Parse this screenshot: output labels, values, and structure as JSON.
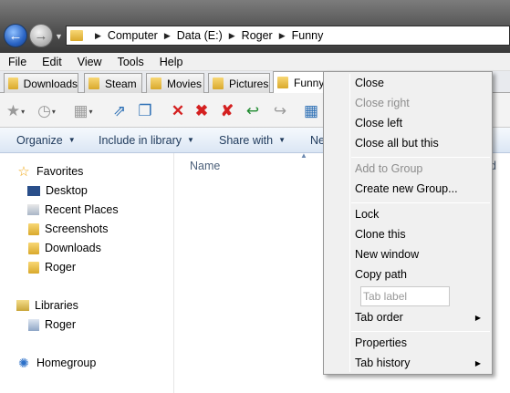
{
  "address": {
    "crumbs": [
      "Computer",
      "Data (E:)",
      "Roger",
      "Funny"
    ]
  },
  "menu": [
    "File",
    "Edit",
    "View",
    "Tools",
    "Help"
  ],
  "tabs": [
    "Downloads",
    "Steam",
    "Movies",
    "Pictures",
    "Funny"
  ],
  "toolbar_icons": [
    "star-icon",
    "history-icon",
    "windows-icon",
    "open-new-icon",
    "clone-icon",
    "close-icon",
    "close-right-icon",
    "close-others-icon",
    "close-left-icon",
    "arrow-icon",
    "view-icon"
  ],
  "commands": {
    "organize": "Organize",
    "include": "Include in library",
    "share": "Share with",
    "new": "Ne"
  },
  "nav": {
    "favorites": "Favorites",
    "fav_items": [
      "Desktop",
      "Recent Places",
      "Screenshots",
      "Downloads",
      "Roger"
    ],
    "libraries": "Libraries",
    "lib_items": [
      "Roger"
    ],
    "homegroup": "Homegroup"
  },
  "content": {
    "col_name": "Name",
    "col_d": "d"
  },
  "context_menu": {
    "close": "Close",
    "close_right": "Close right",
    "close_left": "Close left",
    "close_all_but_this": "Close all but this",
    "add_to_group": "Add to Group",
    "create_new_group": "Create new Group...",
    "lock": "Lock",
    "clone_this": "Clone this",
    "new_window": "New window",
    "copy_path": "Copy path",
    "tab_label_placeholder": "Tab label",
    "tab_order": "Tab order",
    "properties": "Properties",
    "tab_history": "Tab history"
  },
  "colors": {
    "command_text": "#1e395b",
    "disabled_text": "#8d8d8d",
    "folder": "#e8bc45"
  }
}
